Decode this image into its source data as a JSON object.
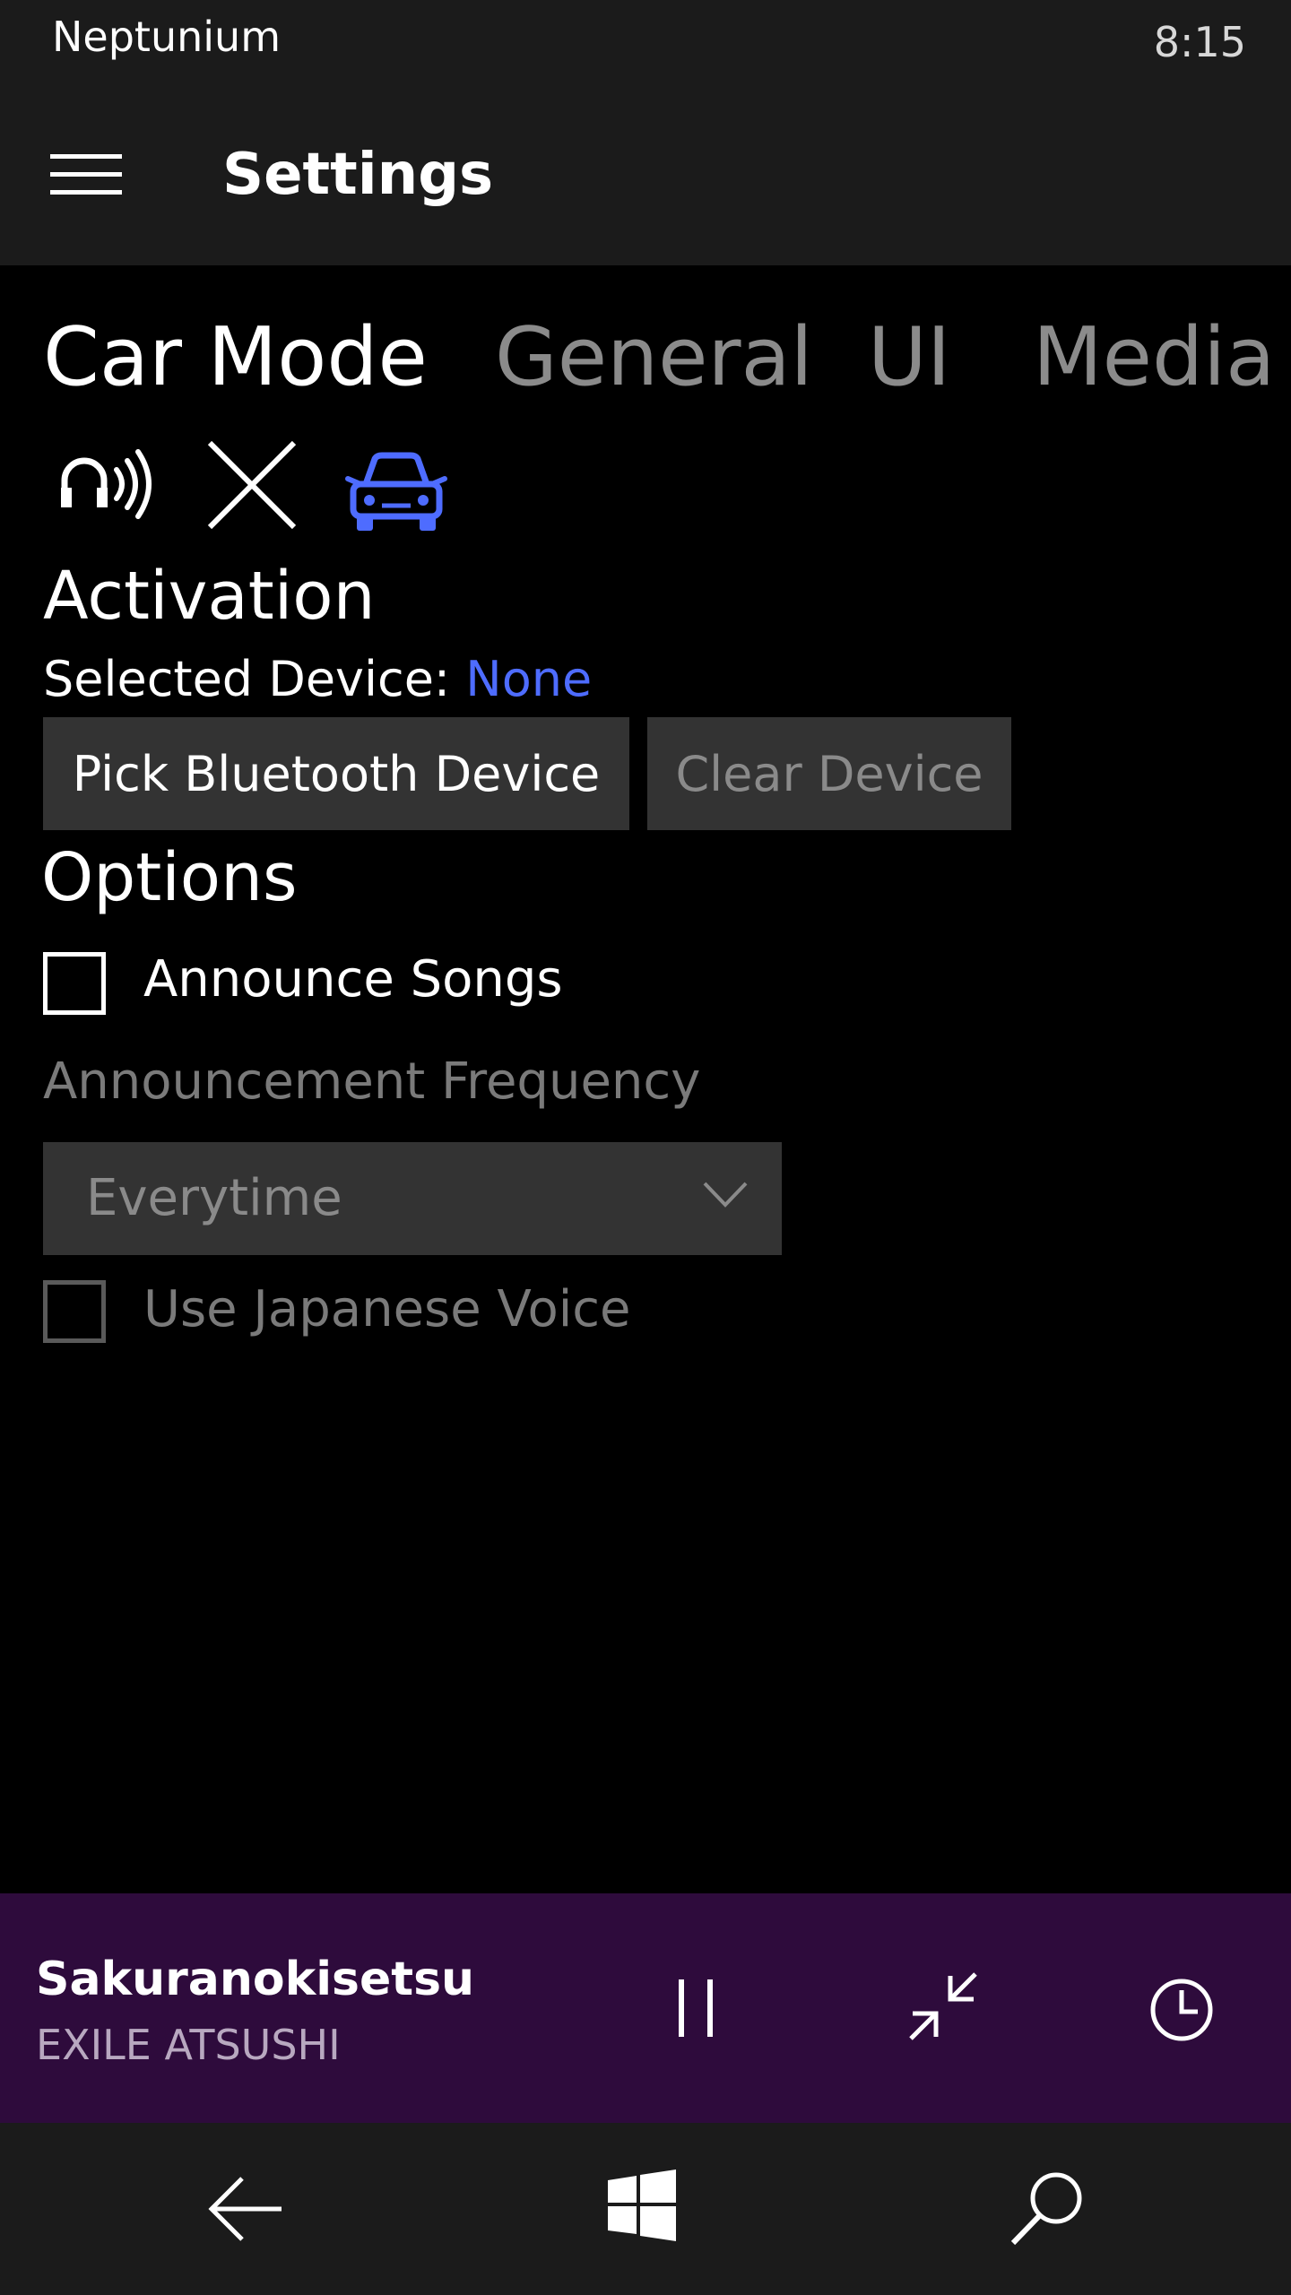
{
  "status_bar": {
    "app_name": "Neptunium",
    "time": "8:15"
  },
  "header": {
    "menu_icon": "hamburger-menu-icon",
    "title": "Settings"
  },
  "tabs": [
    {
      "label": "Car Mode",
      "active": true
    },
    {
      "label": "General",
      "active": false
    },
    {
      "label": "UI",
      "active": false
    },
    {
      "label": "Media",
      "active": false
    }
  ],
  "mode_icons": [
    "headphones-signal-icon",
    "close-icon",
    "car-icon"
  ],
  "activation": {
    "heading": "Activation",
    "selected_device_label": "Selected Device:",
    "selected_device_value": "None",
    "pick_button": "Pick Bluetooth Device",
    "clear_button": "Clear Device"
  },
  "options": {
    "heading": "Options",
    "announce_songs": {
      "label": "Announce Songs",
      "checked": false
    },
    "frequency_label": "Announcement Frequency",
    "frequency_value": "Everytime",
    "japanese_voice": {
      "label": "Use Japanese Voice",
      "checked": false
    }
  },
  "now_playing": {
    "title": "Sakuranokisetsu",
    "artist": "EXILE ATSUSHI",
    "buttons": [
      "pause-icon",
      "collapse-arrows-icon",
      "clock-icon"
    ]
  },
  "nav_bar": {
    "buttons": [
      "back-arrow-icon",
      "windows-logo-icon",
      "search-icon"
    ]
  },
  "colors": {
    "accent": "#4e6cff",
    "bar_background": "#1b1b1b",
    "now_playing_background": "#2e0b3c",
    "control_background": "#333333"
  }
}
